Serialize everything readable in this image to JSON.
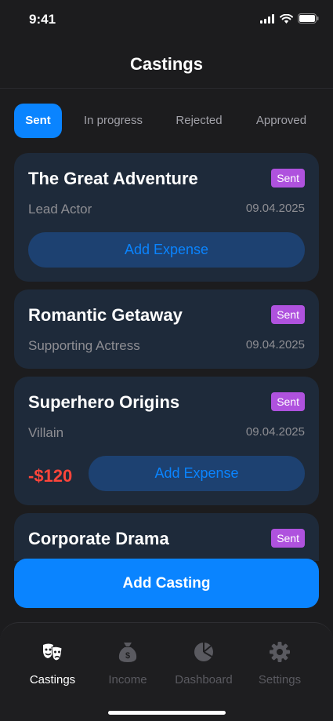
{
  "status": {
    "time": "9:41"
  },
  "header": {
    "title": "Castings"
  },
  "filter_tabs": [
    {
      "label": "Sent"
    },
    {
      "label": "In progress"
    },
    {
      "label": "Rejected"
    },
    {
      "label": "Approved"
    }
  ],
  "castings": [
    {
      "title": "The Great Adventure",
      "status": "Sent",
      "role": "Lead Actor",
      "date": "09.04.2025",
      "expense_label": "Add Expense"
    },
    {
      "title": "Romantic Getaway",
      "status": "Sent",
      "role": "Supporting Actress",
      "date": "09.04.2025"
    },
    {
      "title": "Superhero Origins",
      "status": "Sent",
      "role": "Villain",
      "date": "09.04.2025",
      "amount": "-$120",
      "expense_label": "Add Expense"
    },
    {
      "title": "Corporate Drama",
      "status": "Sent"
    }
  ],
  "add_casting_label": "Add Casting",
  "tab_bar": [
    {
      "label": "Castings",
      "icon": "theater-masks-icon"
    },
    {
      "label": "Income",
      "icon": "money-bag-icon"
    },
    {
      "label": "Dashboard",
      "icon": "pie-chart-icon"
    },
    {
      "label": "Settings",
      "icon": "gear-icon"
    }
  ],
  "colors": {
    "accent": "#0a84ff",
    "badge": "#af52de",
    "negative": "#ff453a",
    "card": "#1e2a3a",
    "background": "#1c1c1e"
  }
}
